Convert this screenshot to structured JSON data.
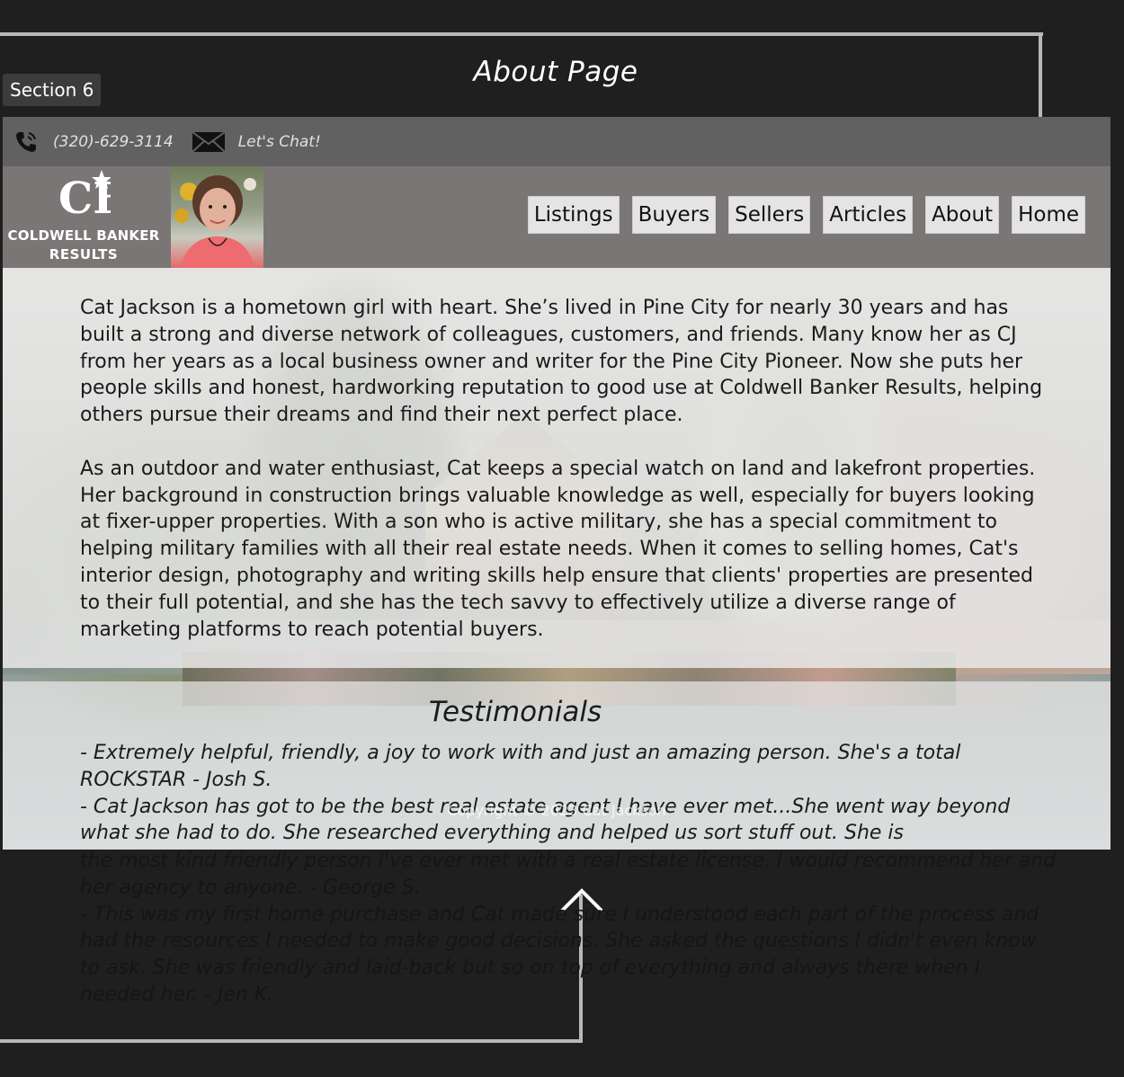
{
  "frame": {
    "title": "About Page",
    "section_label": "Section 6"
  },
  "contact": {
    "phone": "(320)-629-3114",
    "chat": "Let's Chat!"
  },
  "logo": {
    "monogram": "CB",
    "line1": "COLDWELL BANKER",
    "line2": "RESULTS"
  },
  "nav": {
    "items": [
      {
        "label": "Listings"
      },
      {
        "label": "Buyers"
      },
      {
        "label": "Sellers"
      },
      {
        "label": "Articles"
      },
      {
        "label": "About"
      },
      {
        "label": "Home"
      }
    ]
  },
  "about": {
    "paragraphs": [
      "Cat Jackson is a hometown girl with heart. She’s lived in Pine City for nearly 30 years and has built a strong and diverse network of colleagues, customers, and friends. Many know her as CJ from her years as a local business owner and writer for the Pine City Pioneer. Now she puts her people skills and honest, hardworking reputation to good use at Coldwell Banker Results, helping others pursue their dreams and find their next perfect place.",
      "As an outdoor and water enthusiast, Cat keeps a special watch on land and lakefront properties. Her background in construction brings valuable knowledge as well, especially for buyers looking at fixer-upper properties. With a son who is active military, she has a special commitment to helping military families with all their real estate needs. When it comes to selling homes, Cat's interior design, photography and writing skills help ensure that clients' properties are presented to their full potential, and she has the tech savvy to effectively utilize a diverse range of marketing platforms to reach potential buyers."
    ]
  },
  "testimonials": {
    "title": "Testimonials",
    "visible": [
      "- Extremely helpful, friendly, a joy to work with and just an amazing person. She's a total ROCKSTAR - Josh S.",
      "- Cat Jackson has got to be the best real estate agent I have ever met...She went way beyond what she had to do. She researched everything and helped us sort stuff out. She is"
    ],
    "overflow": [
      "the most kind friendly person I've ever met with a real estate license. I would recommend her and her agency to anyone. - George S.",
      "- This was my first home purchase and Cat made sure I understood each part of the process and had the resources I needed to make good decisions. She asked the questions I didn't even know to ask. She was friendly and laid-back but so on top of everything and always there when I needed her. - Jen K."
    ]
  },
  "footer": {
    "copyright": "Copyright © 2023 Cat Jackson"
  },
  "icons": {
    "phone": "phone-icon",
    "mail": "mail-icon",
    "logo": "coldwell-banker-logo",
    "arrow": "arrow-up-icon"
  },
  "colors": {
    "background": "#1f1f1f",
    "contact_bar": "#616161",
    "nav_bar": "#7a7675",
    "nav_button": "#e4e4e4",
    "connector": "#b8b8b8"
  }
}
